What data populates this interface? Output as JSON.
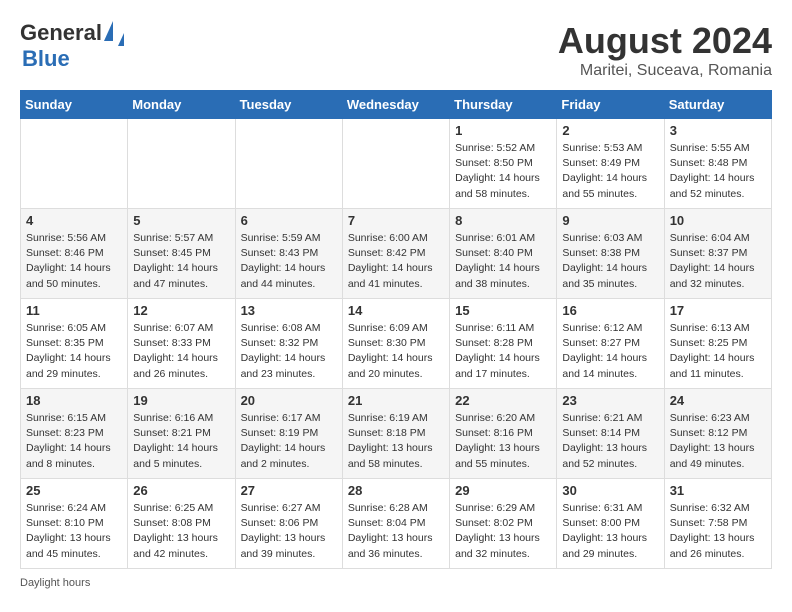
{
  "header": {
    "logo_general": "General",
    "logo_blue": "Blue",
    "month_title": "August 2024",
    "subtitle": "Maritei, Suceava, Romania"
  },
  "days_of_week": [
    "Sunday",
    "Monday",
    "Tuesday",
    "Wednesday",
    "Thursday",
    "Friday",
    "Saturday"
  ],
  "footer": {
    "daylight_label": "Daylight hours"
  },
  "weeks": [
    {
      "days": [
        {
          "num": "",
          "info": ""
        },
        {
          "num": "",
          "info": ""
        },
        {
          "num": "",
          "info": ""
        },
        {
          "num": "",
          "info": ""
        },
        {
          "num": "1",
          "info": "Sunrise: 5:52 AM\nSunset: 8:50 PM\nDaylight: 14 hours\nand 58 minutes."
        },
        {
          "num": "2",
          "info": "Sunrise: 5:53 AM\nSunset: 8:49 PM\nDaylight: 14 hours\nand 55 minutes."
        },
        {
          "num": "3",
          "info": "Sunrise: 5:55 AM\nSunset: 8:48 PM\nDaylight: 14 hours\nand 52 minutes."
        }
      ]
    },
    {
      "days": [
        {
          "num": "4",
          "info": "Sunrise: 5:56 AM\nSunset: 8:46 PM\nDaylight: 14 hours\nand 50 minutes."
        },
        {
          "num": "5",
          "info": "Sunrise: 5:57 AM\nSunset: 8:45 PM\nDaylight: 14 hours\nand 47 minutes."
        },
        {
          "num": "6",
          "info": "Sunrise: 5:59 AM\nSunset: 8:43 PM\nDaylight: 14 hours\nand 44 minutes."
        },
        {
          "num": "7",
          "info": "Sunrise: 6:00 AM\nSunset: 8:42 PM\nDaylight: 14 hours\nand 41 minutes."
        },
        {
          "num": "8",
          "info": "Sunrise: 6:01 AM\nSunset: 8:40 PM\nDaylight: 14 hours\nand 38 minutes."
        },
        {
          "num": "9",
          "info": "Sunrise: 6:03 AM\nSunset: 8:38 PM\nDaylight: 14 hours\nand 35 minutes."
        },
        {
          "num": "10",
          "info": "Sunrise: 6:04 AM\nSunset: 8:37 PM\nDaylight: 14 hours\nand 32 minutes."
        }
      ]
    },
    {
      "days": [
        {
          "num": "11",
          "info": "Sunrise: 6:05 AM\nSunset: 8:35 PM\nDaylight: 14 hours\nand 29 minutes."
        },
        {
          "num": "12",
          "info": "Sunrise: 6:07 AM\nSunset: 8:33 PM\nDaylight: 14 hours\nand 26 minutes."
        },
        {
          "num": "13",
          "info": "Sunrise: 6:08 AM\nSunset: 8:32 PM\nDaylight: 14 hours\nand 23 minutes."
        },
        {
          "num": "14",
          "info": "Sunrise: 6:09 AM\nSunset: 8:30 PM\nDaylight: 14 hours\nand 20 minutes."
        },
        {
          "num": "15",
          "info": "Sunrise: 6:11 AM\nSunset: 8:28 PM\nDaylight: 14 hours\nand 17 minutes."
        },
        {
          "num": "16",
          "info": "Sunrise: 6:12 AM\nSunset: 8:27 PM\nDaylight: 14 hours\nand 14 minutes."
        },
        {
          "num": "17",
          "info": "Sunrise: 6:13 AM\nSunset: 8:25 PM\nDaylight: 14 hours\nand 11 minutes."
        }
      ]
    },
    {
      "days": [
        {
          "num": "18",
          "info": "Sunrise: 6:15 AM\nSunset: 8:23 PM\nDaylight: 14 hours\nand 8 minutes."
        },
        {
          "num": "19",
          "info": "Sunrise: 6:16 AM\nSunset: 8:21 PM\nDaylight: 14 hours\nand 5 minutes."
        },
        {
          "num": "20",
          "info": "Sunrise: 6:17 AM\nSunset: 8:19 PM\nDaylight: 14 hours\nand 2 minutes."
        },
        {
          "num": "21",
          "info": "Sunrise: 6:19 AM\nSunset: 8:18 PM\nDaylight: 13 hours\nand 58 minutes."
        },
        {
          "num": "22",
          "info": "Sunrise: 6:20 AM\nSunset: 8:16 PM\nDaylight: 13 hours\nand 55 minutes."
        },
        {
          "num": "23",
          "info": "Sunrise: 6:21 AM\nSunset: 8:14 PM\nDaylight: 13 hours\nand 52 minutes."
        },
        {
          "num": "24",
          "info": "Sunrise: 6:23 AM\nSunset: 8:12 PM\nDaylight: 13 hours\nand 49 minutes."
        }
      ]
    },
    {
      "days": [
        {
          "num": "25",
          "info": "Sunrise: 6:24 AM\nSunset: 8:10 PM\nDaylight: 13 hours\nand 45 minutes."
        },
        {
          "num": "26",
          "info": "Sunrise: 6:25 AM\nSunset: 8:08 PM\nDaylight: 13 hours\nand 42 minutes."
        },
        {
          "num": "27",
          "info": "Sunrise: 6:27 AM\nSunset: 8:06 PM\nDaylight: 13 hours\nand 39 minutes."
        },
        {
          "num": "28",
          "info": "Sunrise: 6:28 AM\nSunset: 8:04 PM\nDaylight: 13 hours\nand 36 minutes."
        },
        {
          "num": "29",
          "info": "Sunrise: 6:29 AM\nSunset: 8:02 PM\nDaylight: 13 hours\nand 32 minutes."
        },
        {
          "num": "30",
          "info": "Sunrise: 6:31 AM\nSunset: 8:00 PM\nDaylight: 13 hours\nand 29 minutes."
        },
        {
          "num": "31",
          "info": "Sunrise: 6:32 AM\nSunset: 7:58 PM\nDaylight: 13 hours\nand 26 minutes."
        }
      ]
    }
  ]
}
